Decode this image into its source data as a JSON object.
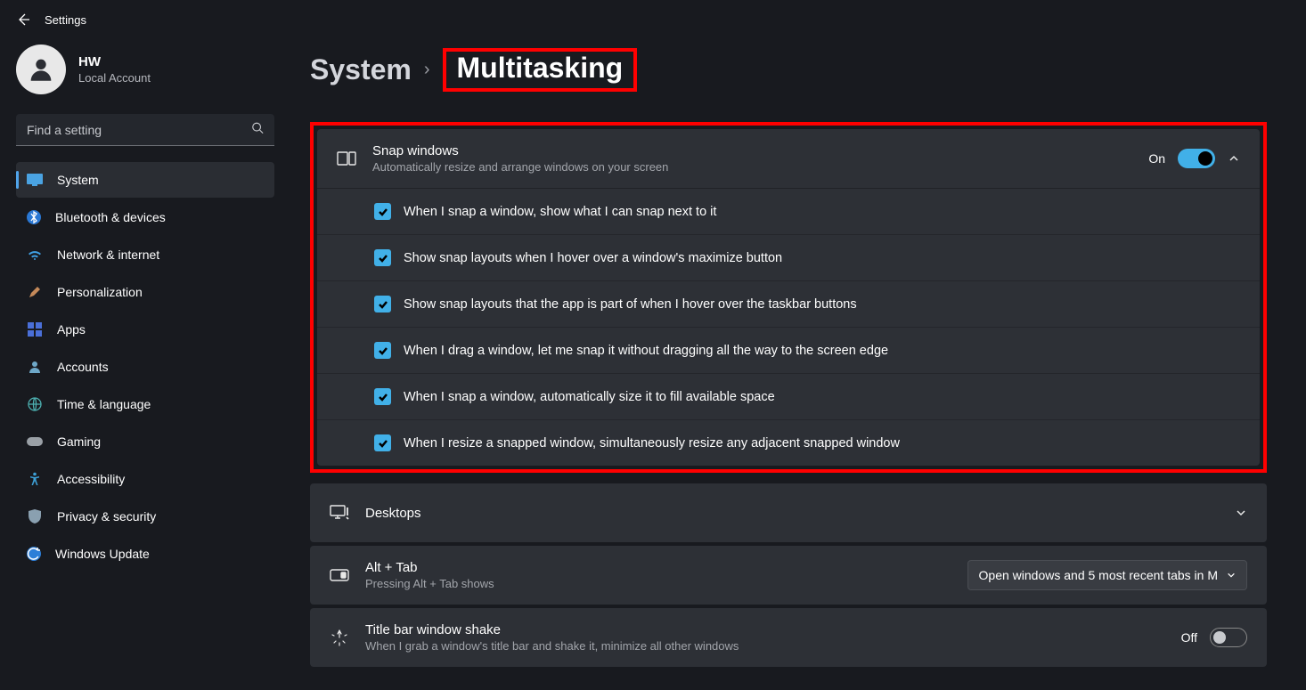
{
  "app_title": "Settings",
  "user": {
    "name": "HW",
    "sub": "Local Account"
  },
  "search": {
    "placeholder": "Find a setting"
  },
  "sidebar": {
    "items": [
      {
        "label": "System"
      },
      {
        "label": "Bluetooth & devices"
      },
      {
        "label": "Network & internet"
      },
      {
        "label": "Personalization"
      },
      {
        "label": "Apps"
      },
      {
        "label": "Accounts"
      },
      {
        "label": "Time & language"
      },
      {
        "label": "Gaming"
      },
      {
        "label": "Accessibility"
      },
      {
        "label": "Privacy & security"
      },
      {
        "label": "Windows Update"
      }
    ]
  },
  "breadcrumb": {
    "a": "System",
    "b": "Multitasking"
  },
  "snap": {
    "title": "Snap windows",
    "sub": "Automatically resize and arrange windows on your screen",
    "state": "On",
    "options": [
      "When I snap a window, show what I can snap next to it",
      "Show snap layouts when I hover over a window's maximize button",
      "Show snap layouts that the app is part of when I hover over the taskbar buttons",
      "When I drag a window, let me snap it without dragging all the way to the screen edge",
      "When I snap a window, automatically size it to fill available space",
      "When I resize a snapped window, simultaneously resize any adjacent snapped window"
    ]
  },
  "desktops": {
    "title": "Desktops"
  },
  "alttab": {
    "title": "Alt + Tab",
    "sub": "Pressing Alt + Tab shows",
    "value": "Open windows and 5 most recent tabs in M"
  },
  "shake": {
    "title": "Title bar window shake",
    "sub": "When I grab a window's title bar and shake it, minimize all other windows",
    "state": "Off"
  }
}
